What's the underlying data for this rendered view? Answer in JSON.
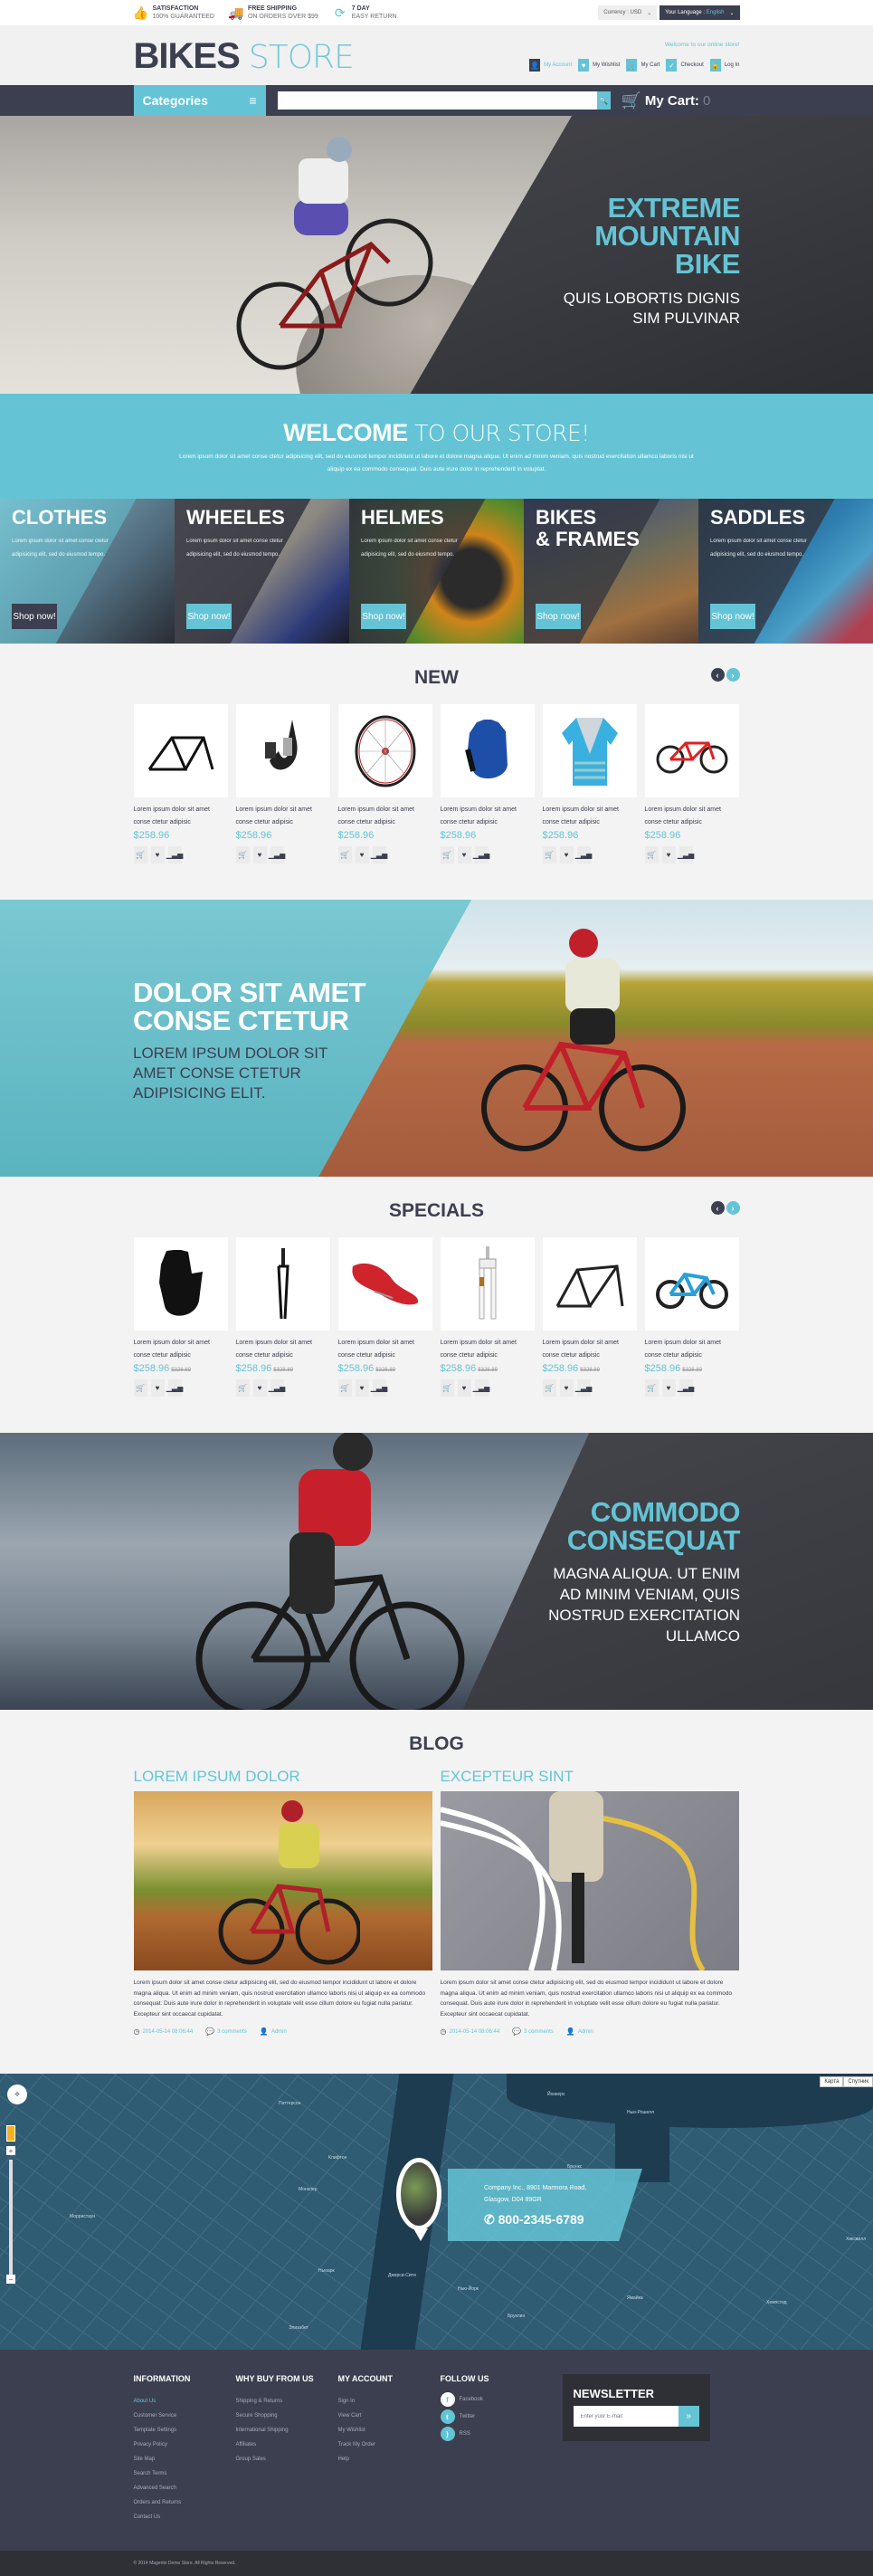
{
  "topbar": {
    "promos": [
      {
        "icon": "thumbs-up-icon",
        "title": "SATISFACTION",
        "sub": "100% GUARANTEED"
      },
      {
        "icon": "truck-icon",
        "title": "FREE SHIPPING",
        "sub": "ON ORDERS OVER $99"
      },
      {
        "icon": "refresh-icon",
        "title": "7 DAY",
        "sub": "EASY RETURN"
      }
    ],
    "currency_label": "Currency :",
    "currency_value": "USD",
    "language_label": "Your Language :",
    "language_value": "English"
  },
  "header": {
    "logo_bold": "BIKES",
    "logo_light": "STORE",
    "welcome": "Welcome to our online store!",
    "links": [
      {
        "label": "My Account",
        "icon": "user-icon",
        "active": true
      },
      {
        "label": "My Wishlist",
        "icon": "heart-icon",
        "active": false
      },
      {
        "label": "My Cart",
        "icon": "cart-icon",
        "active": false
      },
      {
        "label": "Checkout",
        "icon": "check-icon",
        "active": false
      },
      {
        "label": "Log In",
        "icon": "lock-icon",
        "active": false
      }
    ]
  },
  "nav": {
    "categories_label": "Categories",
    "search_placeholder": "",
    "cart_label": "My Cart:",
    "cart_count": "0"
  },
  "hero": {
    "headline": [
      "EXTREME",
      "MOUNTAIN",
      "BIKE"
    ],
    "sub": [
      "QUIS LOBORTIS DIGNIS",
      "SIM PULVINAR"
    ]
  },
  "welcome": {
    "bold": "WELCOME",
    "light": " TO OUR STORE!",
    "text": "Lorem ipsum dolor sit amet conse ctetur adipisicing elit, sed do eiusmod tempor incididunt ut labore et dolore magna aliqua. Ut enim ad minim veniam, quis nostrud exercitation ullamco laboris nisi ut aliquip ex ea commodo consequat. Duis aute irure dolor in reprehenderit in voluptat."
  },
  "categories": [
    {
      "title": "CLOTHES",
      "desc": "Lorem ipsum dolor sit amet conse ctetur adipisicing elit, sed do eiusmod tempo.",
      "button": "Shop now!"
    },
    {
      "title": "WHEELES",
      "desc": "Lorem ipsum dolor sit amet conse ctetur adipisicing elit, sed do eiusmod tempo.",
      "button": "Shop now!"
    },
    {
      "title": "HELMES",
      "desc": "Lorem ipsum dolor sit amet conse ctetur adipisicing elit, sed do eiusmod tempo.",
      "button": "Shop now!"
    },
    {
      "title": "BIKES\n& FRAMES",
      "desc": "",
      "button": "Shop now!"
    },
    {
      "title": "SADDLES",
      "desc": "Lorem ipsum dolor sit amet conse ctetur adipisicing elit, sed do eiusmod tempo.",
      "button": "Shop now!"
    }
  ],
  "new_products": {
    "title": "NEW",
    "items": [
      {
        "name": "Lorem ipsum dolor sit amet conse ctetur adipisic",
        "price": "$258.96",
        "image": "bike-frame"
      },
      {
        "name": "Lorem ipsum dolor sit amet conse ctetur adipisic",
        "price": "$258.96",
        "image": "brake-caliper"
      },
      {
        "name": "Lorem ipsum dolor sit amet conse ctetur adipisic",
        "price": "$258.96",
        "image": "wheel"
      },
      {
        "name": "Lorem ipsum dolor sit amet conse ctetur adipisic",
        "price": "$258.96",
        "image": "blue-glove"
      },
      {
        "name": "Lorem ipsum dolor sit amet conse ctetur adipisic",
        "price": "$258.96",
        "image": "jersey"
      },
      {
        "name": "Lorem ipsum dolor sit amet conse ctetur adipisic",
        "price": "$258.96",
        "image": "red-bike"
      }
    ]
  },
  "banner2": {
    "headline": [
      "DOLOR SIT AMET",
      "CONSE CTETUR"
    ],
    "sub": [
      "LOREM IPSUM DOLOR SIT",
      "AMET CONSE CTETUR",
      "ADIPISICING ELIT."
    ]
  },
  "specials": {
    "title": "SPECIALS",
    "items": [
      {
        "name": "Lorem ipsum dolor sit amet conse ctetur adipisic",
        "price": "$258.96",
        "old_price": "$328.89",
        "image": "black-glove"
      },
      {
        "name": "Lorem ipsum dolor sit amet conse ctetur adipisic",
        "price": "$258.96",
        "old_price": "$328.89",
        "image": "fork"
      },
      {
        "name": "Lorem ipsum dolor sit amet conse ctetur adipisic",
        "price": "$258.96",
        "old_price": "$328.89",
        "image": "saddle"
      },
      {
        "name": "Lorem ipsum dolor sit amet conse ctetur adipisic",
        "price": "$258.96",
        "old_price": "$328.89",
        "image": "suspension-fork"
      },
      {
        "name": "Lorem ipsum dolor sit amet conse ctetur adipisic",
        "price": "$258.96",
        "old_price": "$328.89",
        "image": "frame"
      },
      {
        "name": "Lorem ipsum dolor sit amet conse ctetur adipisic",
        "price": "$258.96",
        "old_price": "$328.89",
        "image": "blue-bike"
      }
    ]
  },
  "banner3": {
    "headline": [
      "COMMODO",
      "CONSEQUAT"
    ],
    "sub": [
      "MAGNA ALIQUA. UT ENIM",
      "AD MINIM VENIAM, QUIS",
      "NOSTRUD EXERCITATION",
      "ULLAMCO"
    ]
  },
  "blog": {
    "title": "BLOG",
    "posts": [
      {
        "title": "LOREM IPSUM DOLOR",
        "text": "Lorem ipsum dolor sit amet conse ctetur adipisicing elit, sed do eiusmod tempor incididunt ut labore et dolore magna aliqua. Ut enim ad minim veniam, quis nostrud exercitation ullamco laboris nisi ut aliquip ex ea commodo consequat. Duis aute irure dolor in reprehenderit in voluptate velit esse cillum dolore eu fugiat nulla pariatur. Excepteur sint occaecat cupidatat.",
        "date": "2014-05-14 08:06:44",
        "comments": "3 comments",
        "author": "Admin"
      },
      {
        "title": "EXCEPTEUR SINT",
        "text": "Lorem ipsum dolor sit amet conse ctetur adipisicing elit, sed do eiusmod tempor incididunt ut labore et dolore magna aliqua. Ut enim ad minim veniam, quis nostrud exercitation ullamco laboris nisi ut aliquip ex ea commodo consequat. Duis aute irure dolor in reprehenderit in voluptate velit esse cillum dolore eu fugiat nulla pariatur. Excepteur sint occaecat cupidatat.",
        "date": "2014-05-14 08:06:44",
        "comments": "3 comments",
        "author": "Admin"
      }
    ]
  },
  "map": {
    "address": [
      "Company Inc., 8901 Marmora Road,",
      "Glasgow, D04 89GR"
    ],
    "phone": "800-2345-6789",
    "map_type_buttons": [
      "Карта",
      "Спутник"
    ],
    "labels": [
      "Паттерсон",
      "Клифтон",
      "Бронкс",
      "Ньюарк",
      "Джерси-Сити",
      "Нью-Йорк",
      "Бруклин",
      "Ямайка",
      "Хемпстед",
      "Йонкерс",
      "Нью-Рошелл",
      "Элизабет",
      "Хиксвилл",
      "Монклер",
      "Морристаун"
    ]
  },
  "footer": {
    "columns": [
      {
        "title": "INFORMATION",
        "items": [
          "About Us",
          "Customer Service",
          "Template Settings",
          "Privacy Policy",
          "Site Map",
          "Search Terms",
          "Advanced Search",
          "Orders and Returns",
          "Contact Us"
        ],
        "active": 0
      },
      {
        "title": "WHY BUY FROM US",
        "items": [
          "Shipping & Returns",
          "Secure Shopping",
          "International Shipping",
          "Affiliates",
          "Group Sales"
        ],
        "active": -1
      },
      {
        "title": "MY ACCOUNT",
        "items": [
          "Sign In",
          "View Cart",
          "My Wishlist",
          "Track My Order",
          "Help"
        ],
        "active": -1
      }
    ],
    "follow": {
      "title": "FOLLOW US",
      "items": [
        {
          "label": "Facebook",
          "icon": "facebook-icon",
          "glyph": "f"
        },
        {
          "label": "Twitter",
          "icon": "twitter-icon",
          "glyph": "t"
        },
        {
          "label": "RSS",
          "icon": "rss-icon",
          "glyph": "))"
        }
      ]
    },
    "newsletter": {
      "title": "NEWSLETTER",
      "placeholder": "Enter yuor E-mail",
      "button_glyph": "»"
    },
    "copyright": "© 2014 Magento Demo Store. All Rights Reserved."
  },
  "colors": {
    "accent": "#64c4d5",
    "dark": "#3c3f50",
    "darker": "#2e3036",
    "background": "#f3f3f3"
  }
}
